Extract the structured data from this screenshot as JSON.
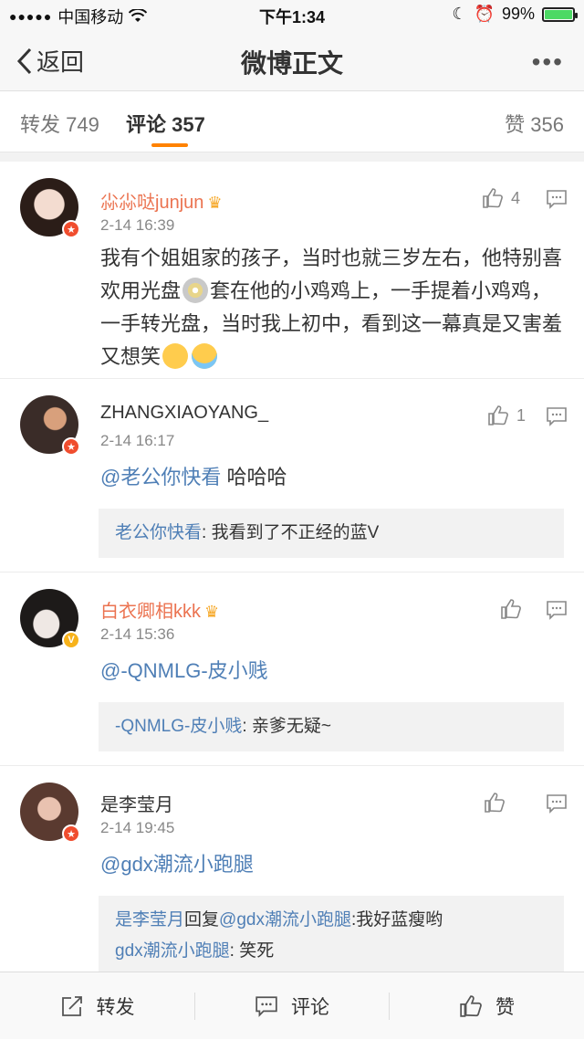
{
  "status_bar": {
    "carrier": "中国移动",
    "time": "下午1:34",
    "battery": "99%",
    "battery_level": 0.99
  },
  "nav": {
    "back_label": "返回",
    "title": "微博正文"
  },
  "tabs": {
    "repost": "转发 749",
    "comment": "评论 357",
    "like": "赞 356"
  },
  "comments": [
    {
      "username": "尛尛哒junjun",
      "time": "2-14 16:39",
      "likes": "4",
      "text_parts": [
        "我有个姐姐家的孩子，当时也就三岁左右，他特别喜欢用光盘",
        "套在他的小鸡鸡上，一手提着小鸡鸡，一手转光盘，当时我上初中，看到这一幕真是又害羞又想笑"
      ]
    },
    {
      "username": "ZHANGXIAOYANG_",
      "time": "2-14 16:17",
      "likes": "1",
      "mention": "@老公你快看",
      "text": " 哈哈哈",
      "reply_name": "老公你快看",
      "reply_text": ": 我看到了不正经的蓝V"
    },
    {
      "username": "白衣卿相kkk",
      "time": "2-14 15:36",
      "likes": "",
      "mention": "@-QNMLG-皮小贱",
      "reply_name": "-QNMLG-皮小贱",
      "reply_text": ": 亲爹无疑~"
    },
    {
      "username": "是李莹月",
      "time": "2-14 19:45",
      "likes": "",
      "mention": "@gdx潮流小跑腿",
      "reply1_name": "是李莹月",
      "reply1_mid": "回复",
      "reply1_mention": "@gdx潮流小跑腿",
      "reply1_text": ":我好蓝瘦哟",
      "reply2_name": "gdx潮流小跑腿",
      "reply2_text": ": 笑死"
    }
  ],
  "bottom_bar": {
    "repost": "转发",
    "comment": "评论",
    "like": "赞"
  },
  "colors": {
    "accent": "#ff8200",
    "link": "#4f7fb6",
    "username_orange": "#eb7350"
  }
}
